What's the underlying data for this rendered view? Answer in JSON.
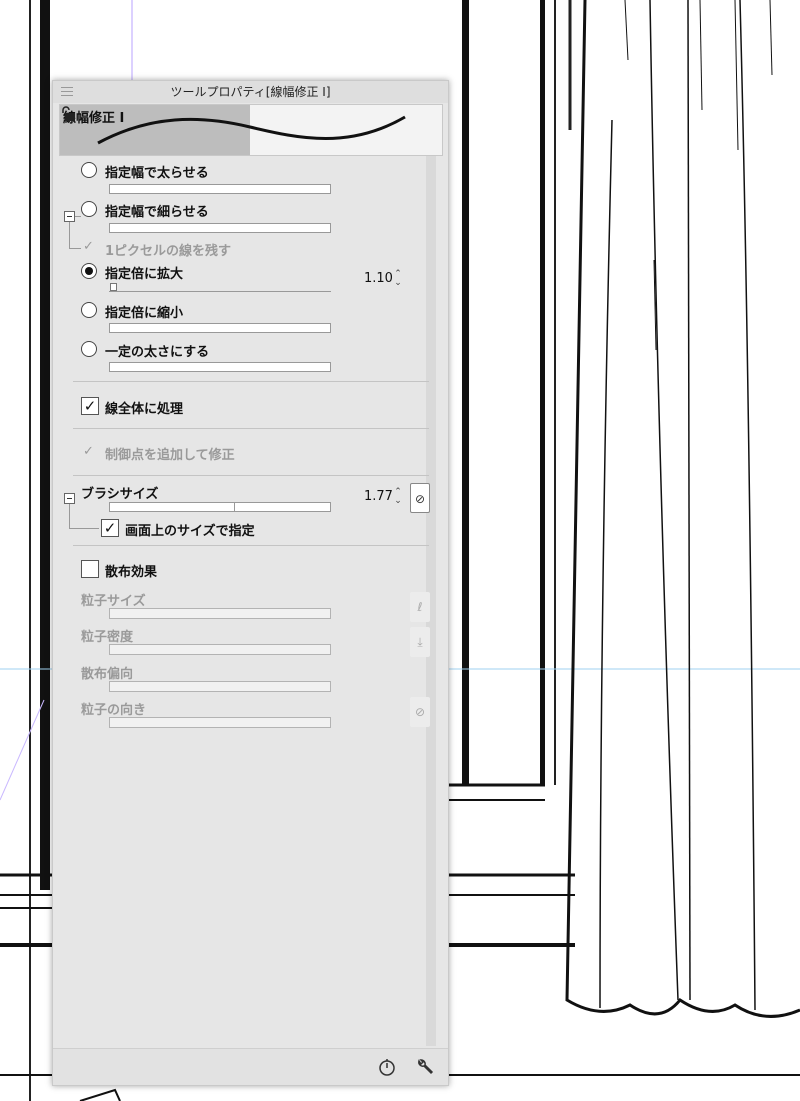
{
  "window": {
    "title": "ツールプロパティ[線幅修正 I]"
  },
  "preview": {
    "tool_name": "線幅修正 I"
  },
  "width_options": [
    {
      "label": "指定幅で太らせる",
      "selected": false
    },
    {
      "label": "指定幅で細らせる",
      "selected": false
    },
    {
      "label": "1ピクセルの線を残す",
      "checked": true,
      "disabled": true
    },
    {
      "label": "指定倍に拡大",
      "selected": true,
      "value": "1.10"
    },
    {
      "label": "指定倍に縮小",
      "selected": false
    },
    {
      "label": "一定の太さにする",
      "selected": false
    }
  ],
  "process_whole_line": {
    "label": "線全体に処理",
    "checked": true
  },
  "add_control_points": {
    "label": "制御点を追加して修正",
    "checked": true,
    "disabled": true
  },
  "brush_size": {
    "label": "ブラシサイズ",
    "value": "1.77",
    "sub_option": {
      "label": "画面上のサイズで指定",
      "checked": true
    }
  },
  "scatter": {
    "label": "散布効果",
    "checked": false,
    "params": [
      "粒子サイズ",
      "粒子密度",
      "散布偏向",
      "粒子の向き"
    ]
  },
  "icons": {
    "menu": "hamburger-menu-icon",
    "lock": "unlock-icon",
    "spinner": "up-down-chevron-icon",
    "pressure": "pen-pressure-icon",
    "download": "download-icon",
    "disabled": "slash-circle-icon",
    "reset": "stopwatch-icon",
    "settings": "wrench-icon"
  }
}
